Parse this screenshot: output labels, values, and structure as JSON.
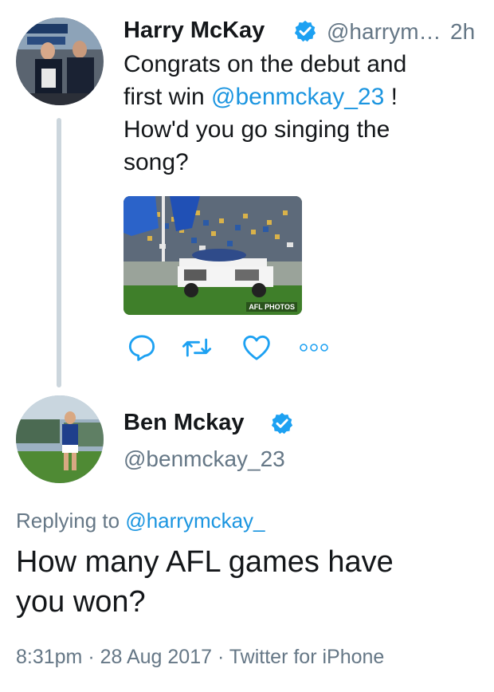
{
  "parent_tweet": {
    "author_name": "Harry McKay",
    "author_handle": "@harrym…",
    "time_ago": "2h",
    "text_line1": "Congrats on the debut and",
    "text_line2_pre": "first win ",
    "text_mention": "@benmckay_23",
    "text_line2_post": " !",
    "text_line3": "How'd you go singing the",
    "text_line4": "song?",
    "media_watermark": "AFL PHOTOS",
    "actions": [
      "reply-icon",
      "retweet-icon",
      "like-icon",
      "more-icon"
    ]
  },
  "reply_tweet": {
    "author_name": "Ben Mckay",
    "author_handle": "@benmckay_23",
    "replying_prefix": "Replying to ",
    "replying_handle": "@harrymckay_",
    "text_line1": "How many AFL games have",
    "text_line2": "you won?",
    "timestamp": "8:31pm · 28 Aug 2017 · Twitter for iPhone"
  },
  "colors": {
    "link": "#1b95e0",
    "secondary": "#657786",
    "verified": "#1da1f2",
    "thread_line": "#ccd6dd"
  }
}
